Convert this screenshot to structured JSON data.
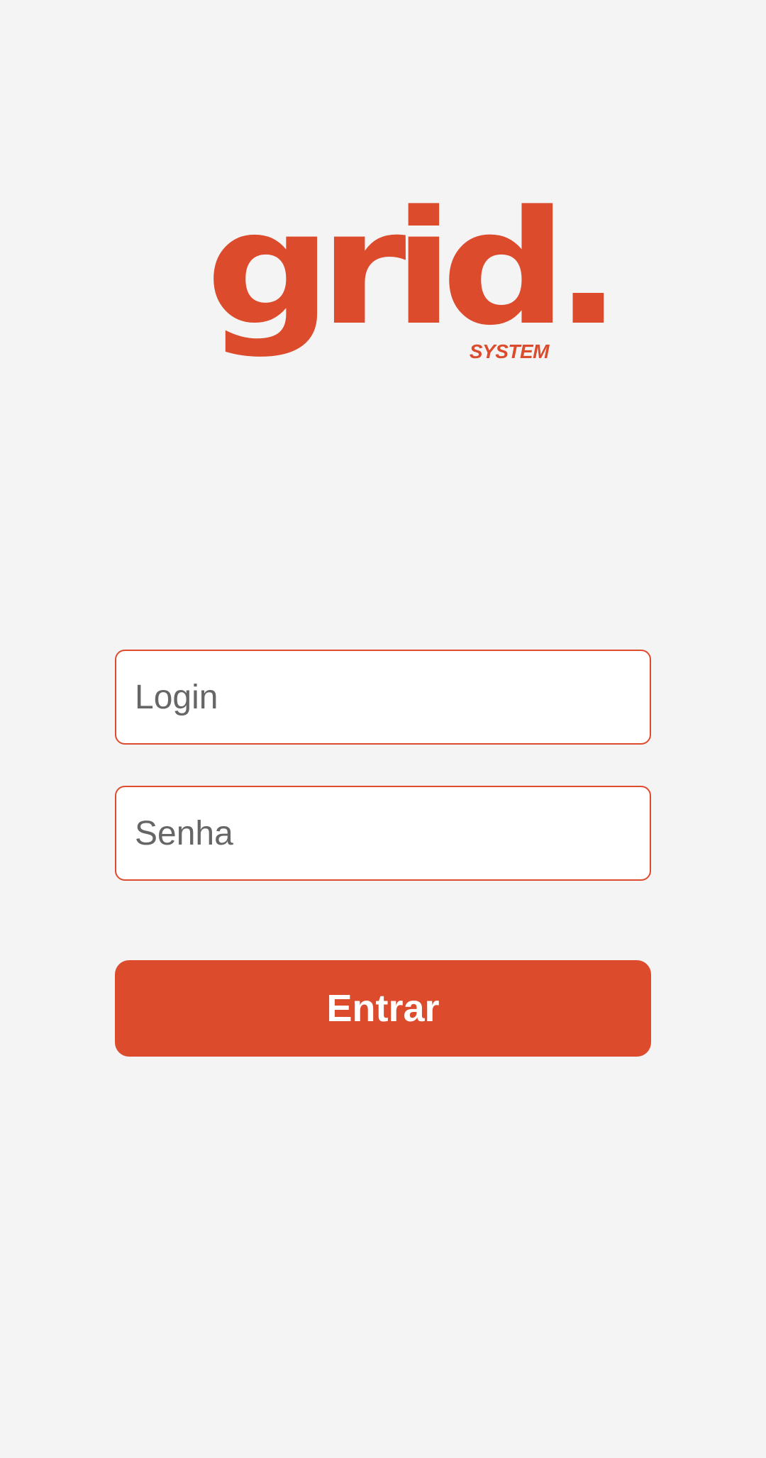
{
  "logo": {
    "wordmark": "grid.",
    "subtitle": "SYSTEM",
    "brand_color": "#dc4b2c"
  },
  "form": {
    "login_placeholder": "Login",
    "password_placeholder": "Senha",
    "submit_label": "Entrar"
  },
  "colors": {
    "background": "#f4f4f4",
    "accent": "#dc4b2c",
    "field_background": "#ffffff",
    "placeholder_text": "#666666",
    "button_text": "#ffffff"
  }
}
